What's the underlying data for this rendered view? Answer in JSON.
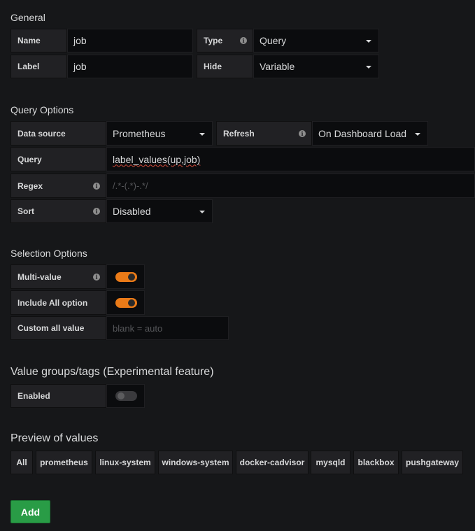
{
  "general": {
    "title": "General",
    "name_label": "Name",
    "name_value": "job",
    "label_label": "Label",
    "label_value": "job",
    "type_label": "Type",
    "type_value": "Query",
    "hide_label": "Hide",
    "hide_value": "Variable"
  },
  "query_options": {
    "title": "Query Options",
    "datasource_label": "Data source",
    "datasource_value": "Prometheus",
    "refresh_label": "Refresh",
    "refresh_value": "On Dashboard Load",
    "query_label": "Query",
    "query_value": "label_values(up,job)",
    "regex_label": "Regex",
    "regex_placeholder": "/.*-(.*)-.*/",
    "sort_label": "Sort",
    "sort_value": "Disabled"
  },
  "selection_options": {
    "title": "Selection Options",
    "multi_value_label": "Multi-value",
    "multi_value_on": true,
    "include_all_label": "Include All option",
    "include_all_on": true,
    "custom_all_label": "Custom all value",
    "custom_all_placeholder": "blank = auto"
  },
  "value_groups": {
    "title": "Value groups/tags (Experimental feature)",
    "enabled_label": "Enabled",
    "enabled_on": false
  },
  "preview": {
    "title": "Preview of values",
    "values": [
      "All",
      "prometheus",
      "linux-system",
      "windows-system",
      "docker-cadvisor",
      "mysqld",
      "blackbox",
      "pushgateway"
    ]
  },
  "actions": {
    "add_label": "Add"
  },
  "colors": {
    "accent_orange": "#eb7b18",
    "add_green": "#299c46",
    "background": "#161719"
  },
  "icons": {
    "info": "info-circle-icon",
    "caret": "caret-down-icon"
  }
}
